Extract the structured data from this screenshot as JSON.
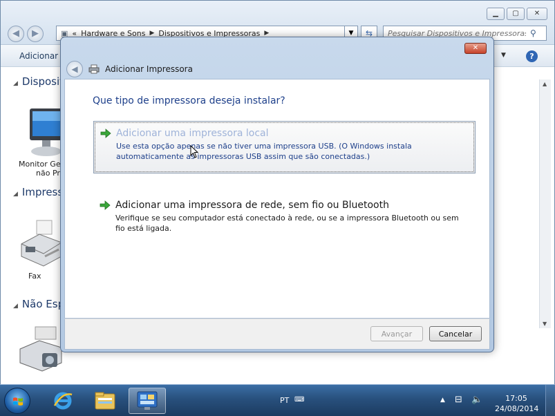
{
  "explorer": {
    "address_crumbs": [
      "«",
      "Hardware e Sons",
      "Dispositivos e Impressoras"
    ],
    "search_placeholder": "Pesquisar Dispositivos e Impressoras",
    "toolbar_label": "Adicionar u",
    "groups": [
      {
        "label": "Dispositi"
      },
      {
        "label": "Impresso"
      },
      {
        "label": "Não Espe"
      }
    ],
    "devices": [
      {
        "line1": "Monitor Ge",
        "line2": "não Pr"
      },
      {
        "line1": "Fax",
        "line2": ""
      }
    ]
  },
  "dialog": {
    "title": "Adicionar Impressora",
    "close_label": "✕",
    "question": "Que tipo de impressora deseja instalar?",
    "options": [
      {
        "title": "Adicionar uma impressora local",
        "description": "Use esta opção apenas se não tiver uma impressora USB. (O Windows instala automaticamente as impressoras USB assim que são conectadas.)"
      },
      {
        "title": "Adicionar uma impressora de rede, sem fio ou Bluetooth",
        "description": "Verifique se seu computador está conectado à rede, ou se a impressora Bluetooth ou sem fio está ligada."
      }
    ],
    "next_label": "Avançar",
    "cancel_label": "Cancelar"
  },
  "taskbar": {
    "language": "PT",
    "time": "17:05",
    "date": "24/08/2014"
  },
  "colors": {
    "link_blue": "#1d3f8a",
    "taskbar": "#28507d",
    "dialog_frame": "#b2c8e2"
  }
}
